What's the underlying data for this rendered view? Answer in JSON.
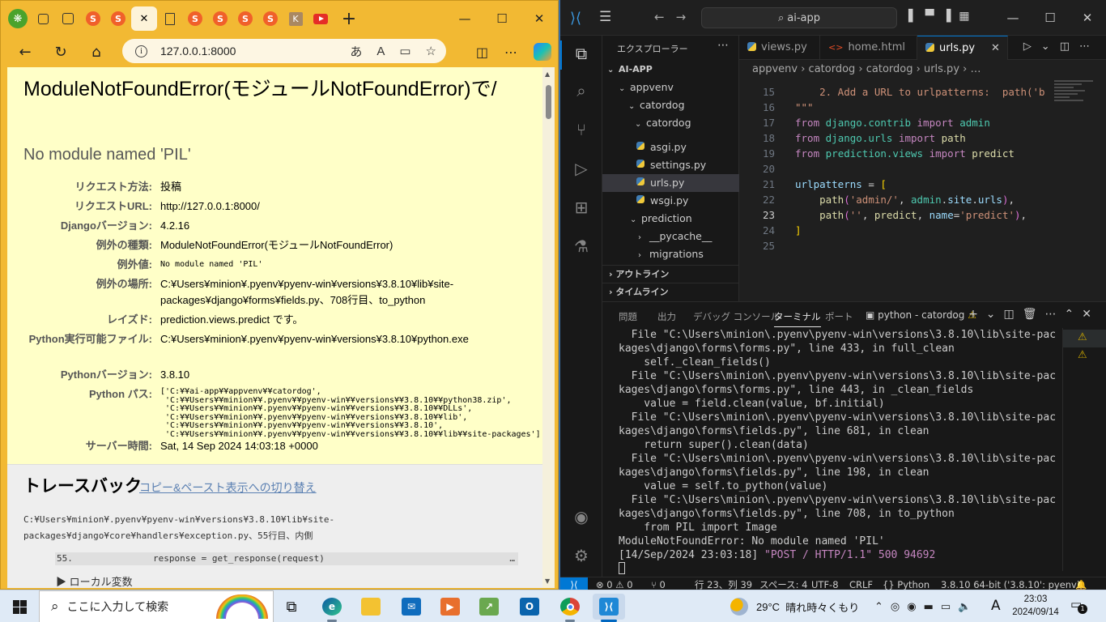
{
  "browser": {
    "tabs": [
      {
        "icon": "copy-tabs-icon"
      },
      {
        "icon": "tab-actions-icon"
      },
      {
        "icon": "site-favicon",
        "letter": "S"
      },
      {
        "icon": "site-favicon",
        "letter": "S"
      },
      {
        "icon": "close-tab-icon",
        "active": true
      },
      {
        "icon": "doc-icon"
      },
      {
        "icon": "site-favicon",
        "letter": "S"
      },
      {
        "icon": "site-favicon",
        "letter": "S"
      },
      {
        "icon": "site-favicon",
        "letter": "S"
      },
      {
        "icon": "site-favicon",
        "letter": "S"
      },
      {
        "icon": "hk-favicon",
        "letter": "K"
      },
      {
        "icon": "youtube-icon"
      }
    ],
    "new_tab": "+",
    "url": "127.0.0.1:8000",
    "addr_icons": [
      "あ",
      "A",
      "▭",
      "☆"
    ],
    "window_controls": {
      "minimize": "—",
      "maximize": "☐",
      "close": "✕"
    }
  },
  "django": {
    "title": "ModuleNotFoundError(モジュールNotFoundError)で/",
    "message": "No module named 'PIL'",
    "meta": [
      {
        "key": "リクエスト方法:",
        "value": "投稿"
      },
      {
        "key": "リクエストURL:",
        "value": "http://127.0.0.1:8000/"
      },
      {
        "key": "Djangoバージョン:",
        "value": "4.2.16"
      },
      {
        "key": "例外の種類:",
        "value": "ModuleNotFoundError(モジュールNotFoundError)"
      },
      {
        "key": "例外値:",
        "value": "No module named 'PIL'"
      },
      {
        "key": "例外の場所:",
        "value": "C:¥Users¥minion¥.pyenv¥pyenv-win¥versions¥3.8.10¥lib¥site-packages¥django¥forms¥fields.py、708行目、to_python"
      },
      {
        "key": "レイズド:",
        "value": "prediction.views.predict です。"
      },
      {
        "key": "Python実行可能ファイル:",
        "value": "C:¥Users¥minion¥.pyenv¥pyenv-win¥versions¥3.8.10¥python.exe"
      },
      {
        "key": "Pythonバージョン:",
        "value": "3.8.10"
      },
      {
        "key": "Python パス:",
        "value": "['C:¥¥ai-app¥¥appvenv¥¥catordog',\n 'C:¥¥Users¥¥minion¥¥.pyenv¥¥pyenv-win¥¥versions¥¥3.8.10¥¥python38.zip',\n 'C:¥¥Users¥¥minion¥¥.pyenv¥¥pyenv-win¥¥versions¥¥3.8.10¥¥DLLs',\n 'C:¥¥Users¥¥minion¥¥.pyenv¥¥pyenv-win¥¥versions¥¥3.8.10¥¥lib',\n 'C:¥¥Users¥¥minion¥¥.pyenv¥¥pyenv-win¥¥versions¥¥3.8.10',\n 'C:¥¥Users¥¥minion¥¥.pyenv¥¥pyenv-win¥¥versions¥¥3.8.10¥¥lib¥¥site-packages']"
      },
      {
        "key": "サーバー時間:",
        "value": "Sat, 14 Sep 2024 14:03:18 +0000"
      }
    ],
    "traceback_title": "トレースバック",
    "traceback_link": "コピー&ペースト表示への切り替え",
    "traceback_path": "C:¥Users¥minion¥.pyenv¥pyenv-win¥versions¥3.8.10¥lib¥site-packages¥django¥core¥handlers¥exception.py、55行目、内側",
    "traceback_lineno": "55.",
    "traceback_code": "response = get_response(request)",
    "traceback_more": "…",
    "local_vars": "▶ ローカル変数"
  },
  "vscode": {
    "search": "ai-app",
    "explorer_title": "エクスプローラー",
    "tree": [
      {
        "label": "AI-APP",
        "indent": 0,
        "chev": "⌄",
        "bold": true
      },
      {
        "label": "appvenv",
        "indent": 1,
        "chev": "⌄"
      },
      {
        "label": "catordog",
        "indent": 2,
        "chev": "⌄"
      },
      {
        "label": "catordog",
        "indent": 3,
        "chev": "⌄"
      },
      {
        "label": "asgi.py",
        "indent": 4,
        "py": true
      },
      {
        "label": "settings.py",
        "indent": 4,
        "py": true
      },
      {
        "label": "urls.py",
        "indent": 4,
        "py": true,
        "selected": true
      },
      {
        "label": "wsgi.py",
        "indent": 4,
        "py": true
      },
      {
        "label": "prediction",
        "indent": 3,
        "chev": "⌄"
      },
      {
        "label": "__pycache__",
        "indent": 4,
        "chev": "›"
      },
      {
        "label": "migrations",
        "indent": 4,
        "chev": "›"
      }
    ],
    "outline": "アウトライン",
    "timeline": "タイムライン",
    "tabs": [
      {
        "label": "views.py",
        "kind": "py"
      },
      {
        "label": "home.html",
        "kind": "html"
      },
      {
        "label": "urls.py",
        "kind": "py",
        "active": true
      }
    ],
    "breadcrumb": "appvenv › catordog › catordog › urls.py › …",
    "code_lines": [
      {
        "n": "15",
        "html": "<span class=\"cm\">    2. Add a URL to urlpatterns:  path('b</span>"
      },
      {
        "n": "16",
        "html": "<span class=\"cm\">\"\"\"</span>"
      },
      {
        "n": "17",
        "html": "<span class=\"kw\">from</span> <span class=\"mod\">django.contrib</span> <span class=\"kw\">import</span> <span class=\"mod\">admin</span>"
      },
      {
        "n": "18",
        "html": "<span class=\"kw\">from</span> <span class=\"mod\">django.urls</span> <span class=\"kw\">import</span> <span class=\"fn\">path</span>"
      },
      {
        "n": "19",
        "html": "<span class=\"kw\">from</span> <span class=\"mod\">prediction.views</span> <span class=\"kw\">import</span> <span class=\"fn\">predict</span>"
      },
      {
        "n": "20",
        "html": ""
      },
      {
        "n": "21",
        "html": "<span class=\"var\">urlpatterns</span> <span class=\"pun\">=</span> <span class=\"br1\">[</span>"
      },
      {
        "n": "22",
        "html": "    <span class=\"fn\">path</span><span class=\"br2\">(</span><span class=\"str\">'admin/'</span><span class=\"pun\">, </span><span class=\"mod\">admin</span><span class=\"pun\">.</span><span class=\"var\">site</span><span class=\"pun\">.</span><span class=\"var\">urls</span><span class=\"br2\">)</span><span class=\"pun\">,</span>"
      },
      {
        "n": "23",
        "html": "    <span class=\"fn\">path</span><span class=\"br2\">(</span><span class=\"str\">''</span><span class=\"pun\">, </span><span class=\"fn\">predict</span><span class=\"pun\">, </span><span class=\"var\">name</span><span class=\"pun\">=</span><span class=\"str\">'predict'</span><span class=\"br2\">)</span><span class=\"pun\">,</span>",
        "current": true
      },
      {
        "n": "24",
        "html": "<span class=\"br1\">]</span>"
      },
      {
        "n": "25",
        "html": ""
      }
    ],
    "panel_tabs": [
      "問題",
      "出力",
      "デバッグ コンソール",
      "ターミナル",
      "ポート"
    ],
    "active_panel": "ターミナル",
    "terminal_name": "python - catordog",
    "terminal_lines": [
      "  File \"C:\\Users\\minion\\.pyenv\\pyenv-win\\versions\\3.8.10\\lib\\site-pac",
      "kages\\django\\forms\\forms.py\", line 433, in full_clean",
      "    self._clean_fields()",
      "  File \"C:\\Users\\minion\\.pyenv\\pyenv-win\\versions\\3.8.10\\lib\\site-pac",
      "kages\\django\\forms\\forms.py\", line 443, in _clean_fields",
      "    value = field.clean(value, bf.initial)",
      "  File \"C:\\Users\\minion\\.pyenv\\pyenv-win\\versions\\3.8.10\\lib\\site-pac",
      "kages\\django\\forms\\fields.py\", line 681, in clean",
      "    return super().clean(data)",
      "  File \"C:\\Users\\minion\\.pyenv\\pyenv-win\\versions\\3.8.10\\lib\\site-pac",
      "kages\\django\\forms\\fields.py\", line 198, in clean",
      "    value = self.to_python(value)",
      "  File \"C:\\Users\\minion\\.pyenv\\pyenv-win\\versions\\3.8.10\\lib\\site-pac",
      "kages\\django\\forms\\fields.py\", line 708, in to_python",
      "    from PIL import Image",
      "ModuleNotFoundError: No module named 'PIL'"
    ],
    "terminal_request_prefix": "[14/Sep/2024 23:03:18] ",
    "terminal_request": "\"POST / HTTP/1.1\" 500 94692",
    "status": {
      "errors": "⊗ 0 ⚠ 0",
      "ports": "⑂ 0",
      "position": "行 23、列 39",
      "spaces": "スペース: 4",
      "encoding": "UTF-8",
      "eol": "CRLF",
      "language": "{} Python",
      "interpreter": "3.8.10 64-bit ('3.8.10': pyenv)",
      "bell": "🔔"
    }
  },
  "taskbar": {
    "search_placeholder": "ここに入力して検索",
    "weather_temp": "29°C",
    "weather_desc": "晴れ時々くもり",
    "ime": "A",
    "time": "23:03",
    "date": "2024/09/14",
    "notification_count": "1"
  }
}
